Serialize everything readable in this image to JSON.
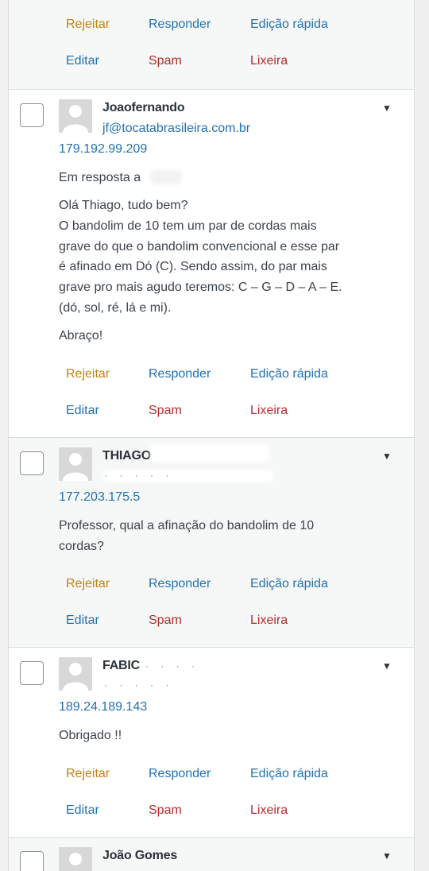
{
  "actions": {
    "reject": "Rejeitar",
    "reply": "Responder",
    "quick_edit": "Edição rápida",
    "edit": "Editar",
    "spam": "Spam",
    "trash": "Lixeira"
  },
  "comments": [
    {
      "author": "Joaofernando",
      "email": "jf@tocatabrasileira.com.br",
      "ip": "179.192.99.209",
      "in_reply_to": "Em resposta a",
      "lines": [
        "Olá Thiago, tudo bem?",
        "O bandolim de 10 tem um par de cordas mais",
        "grave do que o bandolim convencional e esse par",
        "é afinado em Dó (C). Sendo assim, do par mais",
        "grave pro mais agudo teremos: C – G – D – A – E.",
        "(dó, sol, ré, lá e mi)."
      ],
      "closing": "Abraço!"
    },
    {
      "author": "THIAGO",
      "ip": "177.203.175.5",
      "lines": [
        "Professor, qual a afinação do bandolim de 10",
        "cordas?"
      ]
    },
    {
      "author": "FABIC",
      "ip": "189.24.189.143",
      "lines": [
        "Obrigado !!"
      ]
    },
    {
      "author": "João Gomes"
    }
  ],
  "colors": {
    "link": "#2271b1",
    "reject": "#c08212",
    "danger": "#b32d2e",
    "pending_bg": "#f6f7f7"
  }
}
